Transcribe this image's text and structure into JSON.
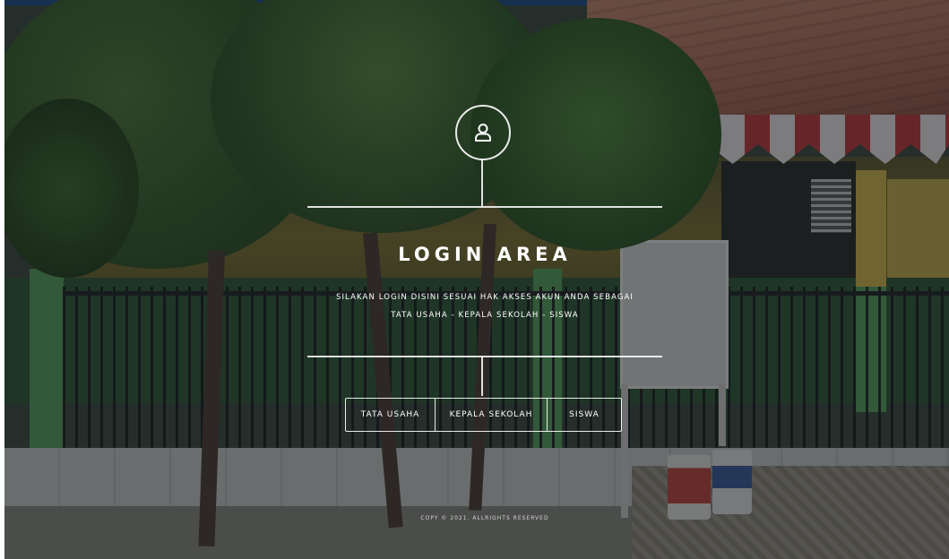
{
  "login": {
    "title": "LOGIN AREA",
    "description_line1": "SILAKAN LOGIN DISINI SESUAI HAK AKSES AKUN ANDA SEBAGAI",
    "description_line2": "TATA USAHA - KEPALA SEKOLAH - SISWA",
    "icon": "user-icon",
    "buttons": [
      {
        "label": "TATA USAHA"
      },
      {
        "label": "KEPALA SEKOLAH"
      },
      {
        "label": "SISWA"
      }
    ]
  },
  "footer": {
    "text": "COPY © 2021. ALLRIGHTS RESERVED"
  },
  "colors": {
    "text": "#ffffff",
    "overlay": "rgba(18,22,26,0.52)",
    "top_strip": "#1d4f8a"
  }
}
